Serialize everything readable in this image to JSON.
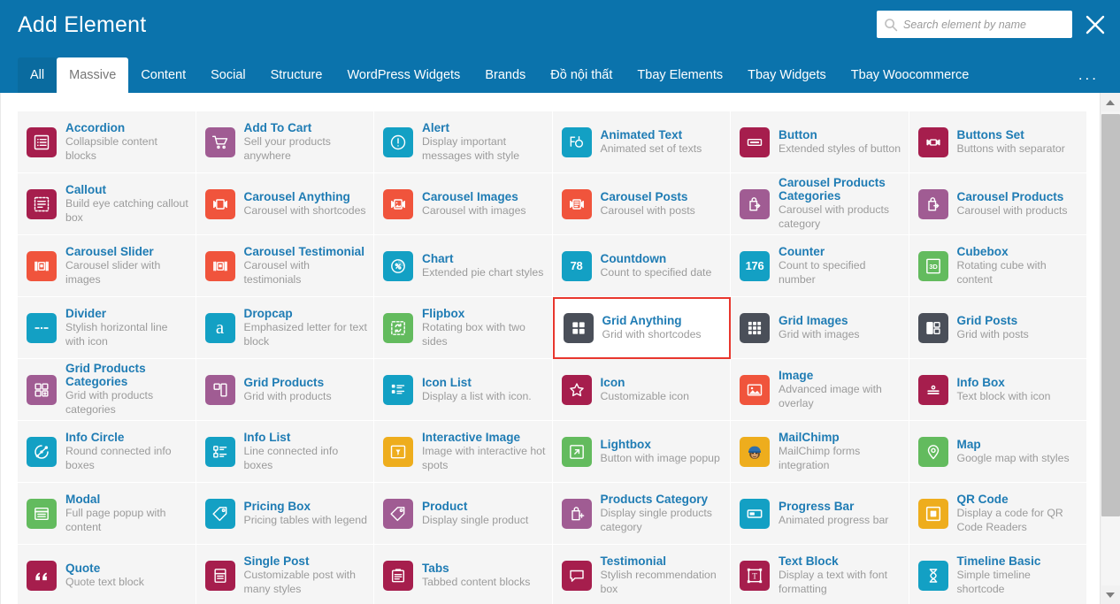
{
  "header": {
    "title": "Add Element",
    "close_icon": "close-icon",
    "search": {
      "placeholder": "Search element by name",
      "value": "",
      "icon": "search-icon"
    }
  },
  "tabs": {
    "items": [
      {
        "label": "All",
        "state": "hovered"
      },
      {
        "label": "Massive",
        "state": "active"
      },
      {
        "label": "Content",
        "state": "normal"
      },
      {
        "label": "Social",
        "state": "normal"
      },
      {
        "label": "Structure",
        "state": "normal"
      },
      {
        "label": "WordPress Widgets",
        "state": "normal"
      },
      {
        "label": "Brands",
        "state": "normal"
      },
      {
        "label": "Đồ nội thất",
        "state": "normal"
      },
      {
        "label": "Tbay Elements",
        "state": "normal"
      },
      {
        "label": "Tbay Widgets",
        "state": "normal"
      },
      {
        "label": "Tbay Woocommerce",
        "state": "normal"
      }
    ],
    "more_label": "..."
  },
  "colors": {
    "brand_blue": "#0b73ac",
    "tab_hover_blue": "#0a6b9f",
    "selection_red": "#e8372e",
    "cell_bg": "#f5f5f5",
    "title_blue": "#1f7cb4",
    "desc_gray": "#9b9b9b",
    "icon_magenta": "#a61e4d",
    "icon_purple": "#a05c93",
    "icon_cyan": "#13a0c4",
    "icon_orange_red": "#f0543c",
    "icon_green": "#63bb5e",
    "icon_dark": "#4a4f59",
    "icon_yellow": "#eead1d"
  },
  "elements": [
    {
      "name": "Accordion",
      "desc": "Collapsible content blocks",
      "icon": "list-lines-icon",
      "color": "#a61e4d"
    },
    {
      "name": "Add To Cart",
      "desc": "Sell your products anywhere",
      "icon": "shopping-cart-icon",
      "color": "#a05c93"
    },
    {
      "name": "Alert",
      "desc": "Display important messages with style",
      "icon": "exclamation-circle-icon",
      "color": "#13a0c4"
    },
    {
      "name": "Animated Text",
      "desc": "Animated set of texts",
      "icon": "animated-text-icon",
      "color": "#13a0c4"
    },
    {
      "name": "Button",
      "desc": "Extended styles of button",
      "icon": "button-rect-icon",
      "color": "#a61e4d"
    },
    {
      "name": "Buttons Set",
      "desc": "Buttons with separator",
      "icon": "buttons-set-icon",
      "color": "#a61e4d"
    },
    {
      "name": "Callout",
      "desc": "Build eye catching callout box",
      "icon": "callout-dashed-icon",
      "color": "#a61e4d"
    },
    {
      "name": "Carousel Anything",
      "desc": "Carousel with shortcodes",
      "icon": "carousel-icon",
      "color": "#f0543c"
    },
    {
      "name": "Carousel Images",
      "desc": "Carousel with images",
      "icon": "carousel-image-icon",
      "color": "#f0543c"
    },
    {
      "name": "Carousel Posts",
      "desc": "Carousel with posts",
      "icon": "carousel-post-icon",
      "color": "#f0543c"
    },
    {
      "name": "Carousel Products Categories",
      "desc": "Carousel with products category",
      "icon": "bag-arrow-icon",
      "color": "#a05c93"
    },
    {
      "name": "Carousel Products",
      "desc": "Carousel with products",
      "icon": "bag-arrow-icon",
      "color": "#a05c93"
    },
    {
      "name": "Carousel Slider",
      "desc": "Carousel slider with images",
      "icon": "carousel-slider-icon",
      "color": "#f0543c"
    },
    {
      "name": "Carousel Testimonial",
      "desc": "Carousel with testimonials",
      "icon": "carousel-slider-icon",
      "color": "#f0543c"
    },
    {
      "name": "Chart",
      "desc": "Extended pie chart styles",
      "icon": "pie-percent-icon",
      "color": "#13a0c4"
    },
    {
      "name": "Countdown",
      "desc": "Count to specified date",
      "icon": "countdown-78-icon",
      "color": "#13a0c4",
      "badge": "78"
    },
    {
      "name": "Counter",
      "desc": "Count to specified number",
      "icon": "counter-176-icon",
      "color": "#13a0c4",
      "badge": "176"
    },
    {
      "name": "Cubebox",
      "desc": "Rotating cube with content",
      "icon": "cube-3d-icon",
      "color": "#63bb5e",
      "badge": "3D"
    },
    {
      "name": "Divider",
      "desc": "Stylish horizontal line with icon",
      "icon": "divider-icon",
      "color": "#13a0c4"
    },
    {
      "name": "Dropcap",
      "desc": "Emphasized letter for text block",
      "icon": "dropcap-a-icon",
      "color": "#13a0c4",
      "badge": "a"
    },
    {
      "name": "Flipbox",
      "desc": "Rotating box with two sides",
      "icon": "flip-box-icon",
      "color": "#63bb5e"
    },
    {
      "name": "Grid Anything",
      "desc": "Grid with shortcodes",
      "icon": "grid-4-icon",
      "color": "#4a4f59",
      "selected": true
    },
    {
      "name": "Grid Images",
      "desc": "Grid with images",
      "icon": "grid-9-icon",
      "color": "#4a4f59"
    },
    {
      "name": "Grid Posts",
      "desc": "Grid with posts",
      "icon": "grid-posts-icon",
      "color": "#4a4f59"
    },
    {
      "name": "Grid Products Categories",
      "desc": "Grid with products categories",
      "icon": "grid-4-square-icon",
      "color": "#a05c93"
    },
    {
      "name": "Grid Products",
      "desc": "Grid with products",
      "icon": "grid-products-icon",
      "color": "#a05c93"
    },
    {
      "name": "Icon List",
      "desc": "Display a list with icon.",
      "icon": "icon-list-icon",
      "color": "#13a0c4"
    },
    {
      "name": "Icon",
      "desc": "Customizable icon",
      "icon": "star-icon",
      "color": "#a61e4d"
    },
    {
      "name": "Image",
      "desc": "Advanced image with overlay",
      "icon": "picture-icon",
      "color": "#f0543c"
    },
    {
      "name": "Info Box",
      "desc": "Text block with icon",
      "icon": "info-box-icon",
      "color": "#a61e4d"
    },
    {
      "name": "Info Circle",
      "desc": "Round connected info boxes",
      "icon": "info-circle-nodes-icon",
      "color": "#13a0c4"
    },
    {
      "name": "Info List",
      "desc": "Line connected info boxes",
      "icon": "info-list-icon",
      "color": "#13a0c4"
    },
    {
      "name": "Interactive Image",
      "desc": "Image with interactive hot spots",
      "icon": "interactive-image-icon",
      "color": "#eead1d"
    },
    {
      "name": "Lightbox",
      "desc": "Button with image popup",
      "icon": "expand-arrow-icon",
      "color": "#63bb5e"
    },
    {
      "name": "MailChimp",
      "desc": "MailChimp forms integration",
      "icon": "mailchimp-monkey-icon",
      "color": "#eead1d"
    },
    {
      "name": "Map",
      "desc": "Google map with styles",
      "icon": "map-pin-icon",
      "color": "#63bb5e"
    },
    {
      "name": "Modal",
      "desc": "Full page popup with content",
      "icon": "modal-window-icon",
      "color": "#63bb5e"
    },
    {
      "name": "Pricing Box",
      "desc": "Pricing tables with legend",
      "icon": "price-tag-icon",
      "color": "#13a0c4"
    },
    {
      "name": "Product",
      "desc": "Display single product",
      "icon": "tag-icon",
      "color": "#a05c93"
    },
    {
      "name": "Products Category",
      "desc": "Display single products category",
      "icon": "bag-plus-icon",
      "color": "#a05c93"
    },
    {
      "name": "Progress Bar",
      "desc": "Animated progress bar",
      "icon": "progress-bar-icon",
      "color": "#13a0c4"
    },
    {
      "name": "QR Code",
      "desc": "Display a code for QR Code Readers",
      "icon": "qr-code-icon",
      "color": "#eead1d"
    },
    {
      "name": "Quote",
      "desc": "Quote text block",
      "icon": "quote-marks-icon",
      "color": "#a61e4d"
    },
    {
      "name": "Single Post",
      "desc": "Customizable post with many styles",
      "icon": "single-post-icon",
      "color": "#a61e4d"
    },
    {
      "name": "Tabs",
      "desc": "Tabbed content blocks",
      "icon": "tabs-icon",
      "color": "#a61e4d"
    },
    {
      "name": "Testimonial",
      "desc": "Stylish recommendation box",
      "icon": "speech-bubble-icon",
      "color": "#a61e4d"
    },
    {
      "name": "Text Block",
      "desc": "Display a text with font formatting",
      "icon": "text-block-t-icon",
      "color": "#a61e4d"
    },
    {
      "name": "Timeline Basic",
      "desc": "Simple timeline shortcode",
      "icon": "hourglass-icon",
      "color": "#13a0c4"
    }
  ],
  "scrollbar": {
    "up_icon": "chevron-up-icon",
    "down_icon": "chevron-down-icon"
  }
}
